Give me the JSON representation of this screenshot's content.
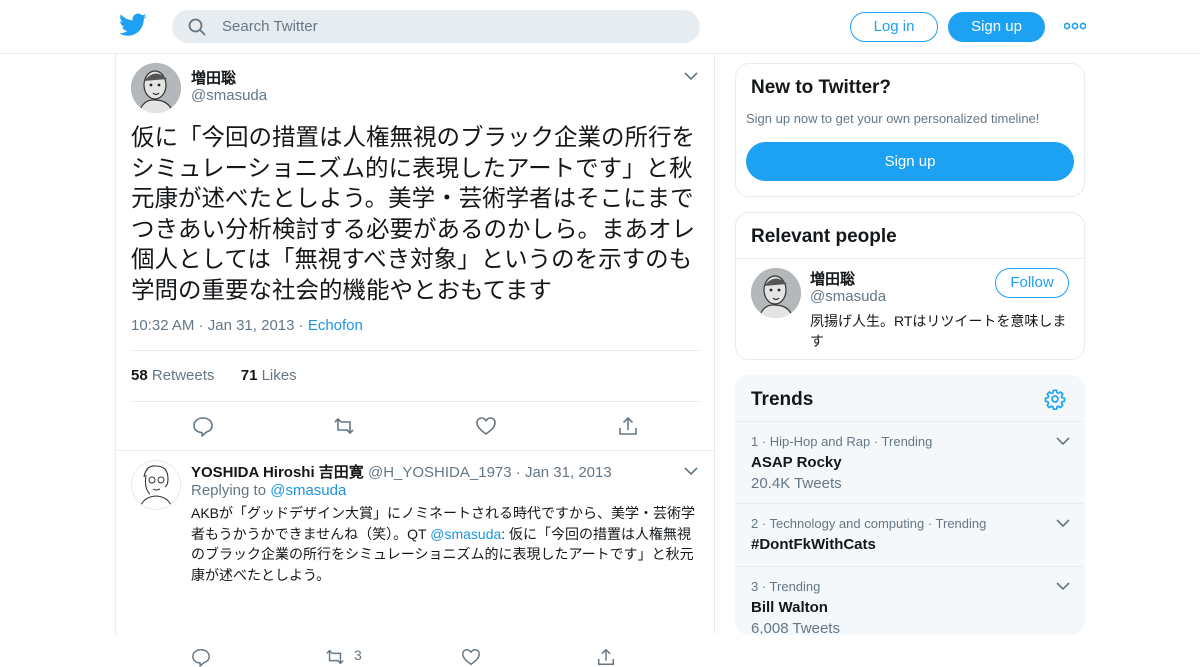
{
  "header": {
    "search_placeholder": "Search Twitter",
    "login_label": "Log in",
    "signup_label": "Sign up",
    "brand_color": "#1da1f2"
  },
  "tweet": {
    "author_name": "増田聡",
    "author_handle": "@smasuda",
    "text": "仮に「今回の措置は人権無視のブラック企業の所行をシミュレーショニズム的に表現したアートです」と秋元康が述べたとしよう。美学・芸術学者はそこにまでつきあい分析検討する必要があるのかしら。まあオレ個人としては「無視すべき対象」というのを示すのも学問の重要な社会的機能やとおもてます",
    "time": "10:32 AM",
    "date": "Jan 31, 2013",
    "source": "Echofon",
    "retweet_count": "58",
    "retweet_label": "Retweets",
    "like_count": "71",
    "like_label": "Likes"
  },
  "reply": {
    "author_name": "YOSHIDA Hiroshi 吉田寛",
    "author_handle": "@H_YOSHIDA_1973",
    "date": "Jan 31, 2013",
    "replying_prefix": "Replying to",
    "replying_to": "@smasuda",
    "text_before": "AKBが「グッドデザイン大賞」にノミネートされる時代ですから、美学・芸術学者もうかうかできませんね（笑）。QT ",
    "text_mention": "@smasuda",
    "text_after": ": 仮に「今回の措置は人権無視のブラック企業の所行をシミュレーショニズム的に表現したアートです」と秋元康が述べたとしよう。",
    "retweet_count": "3"
  },
  "sidebar": {
    "new": {
      "title": "New to Twitter?",
      "subtitle": "Sign up now to get your own personalized timeline!",
      "signup_label": "Sign up"
    },
    "relevant": {
      "title": "Relevant people",
      "name": "増田聡",
      "handle": "@smasuda",
      "follow_label": "Follow",
      "bio": "夙揚げ人生。RTはリツイートを意味します"
    },
    "trends": {
      "title": "Trends",
      "items": [
        {
          "context": "1 · Hip-Hop and Rap · Trending",
          "name": "ASAP Rocky",
          "count": "20.4K Tweets"
        },
        {
          "context": "2 · Technology and computing · Trending",
          "name": "#DontFkWithCats",
          "count": ""
        },
        {
          "context": "3 · Trending",
          "name": "Bill Walton",
          "count": "6,008 Tweets"
        }
      ]
    }
  }
}
